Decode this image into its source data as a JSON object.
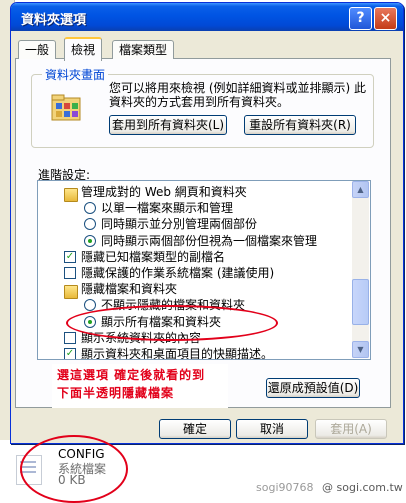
{
  "window": {
    "title": "資料夾選項",
    "help_label": "?",
    "close_label": "×"
  },
  "tabs": [
    {
      "label": "一般"
    },
    {
      "label": "檢視"
    },
    {
      "label": "檔案類型"
    }
  ],
  "folder_views": {
    "title": "資料夾畫面",
    "description": "您可以將用來檢視 (例如詳細資料或並排顯示) 此資料夾的方式套用到所有資料夾。",
    "apply_all_label": "套用到所有資料夾(L)",
    "reset_all_label": "重設所有資料夾(R)"
  },
  "advanced": {
    "label": "進階設定:",
    "items": [
      {
        "type": "folder",
        "label": "管理成對的 Web 網頁和資料夾",
        "indent": 0
      },
      {
        "type": "radio",
        "label": "以單一檔案來顯示和管理",
        "checked": false,
        "indent": 1
      },
      {
        "type": "radio",
        "label": "同時顯示並分別管理兩個部份",
        "checked": false,
        "indent": 1
      },
      {
        "type": "radio",
        "label": "同時顯示兩個部份但視為一個檔案來管理",
        "checked": true,
        "indent": 1
      },
      {
        "type": "check",
        "label": "隱藏已知檔案類型的副檔名",
        "checked": true,
        "indent": 0
      },
      {
        "type": "check",
        "label": "隱藏保護的作業系統檔案 (建議使用)",
        "checked": false,
        "indent": 0
      },
      {
        "type": "folder",
        "label": "隱藏檔案和資料夾",
        "indent": 0
      },
      {
        "type": "radio",
        "label": "不顯示隱藏的檔案和資料夾",
        "checked": false,
        "indent": 1
      },
      {
        "type": "radio",
        "label": "顯示所有檔案和資料夾",
        "checked": true,
        "indent": 1
      },
      {
        "type": "check",
        "label": "顯示系統資料夾的內容",
        "checked": false,
        "indent": 0
      },
      {
        "type": "check",
        "label": "顯示資料夾和桌面項目的快顯描述。",
        "checked": true,
        "indent": 0
      }
    ]
  },
  "annotation": {
    "line1": "選這選項  確定後就看的到",
    "line2": "下面半透明隱藏檔案"
  },
  "buttons": {
    "restore_defaults": "還原成預設值(D)",
    "ok": "確定",
    "cancel": "取消",
    "apply": "套用(A)"
  },
  "hidden_file": {
    "name": "CONFIG",
    "type": "系統檔案",
    "size": "0 KB"
  },
  "watermark": {
    "user": "sogi90768",
    "site": "@ sogi.com.tw"
  },
  "colors": {
    "annotation_red": "#e2001a",
    "titlebar_blue": "#0054e3",
    "group_title_blue": "#0046d5"
  }
}
